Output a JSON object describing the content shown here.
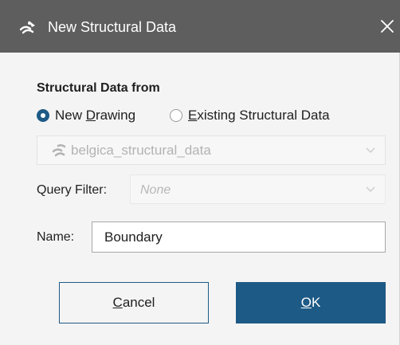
{
  "window": {
    "title": "New Structural Data",
    "title_icon": "structural-data-icon",
    "close_icon": "close-icon"
  },
  "form": {
    "section_label": "Structural Data from",
    "radio_options": [
      {
        "label_prefix": "New ",
        "mnemonic": "D",
        "label_suffix": "rawing",
        "checked": true
      },
      {
        "label_prefix": "",
        "mnemonic": "E",
        "label_suffix": "xisting Structural Data",
        "checked": false
      }
    ],
    "structural_data_select": {
      "value": "belgica_structural_data",
      "icon": "structural-data-icon"
    },
    "query_filter": {
      "label": "Query Filter:",
      "value": "None"
    },
    "name": {
      "label": "Name:",
      "value": "Boundary"
    }
  },
  "buttons": {
    "cancel": {
      "mnemonic": "C",
      "rest": "ancel"
    },
    "ok": {
      "mnemonic": "O",
      "rest": "K"
    }
  },
  "colors": {
    "titlebar": "#5e5e5e",
    "accent": "#1e5a86",
    "background": "#f4f4f4"
  }
}
